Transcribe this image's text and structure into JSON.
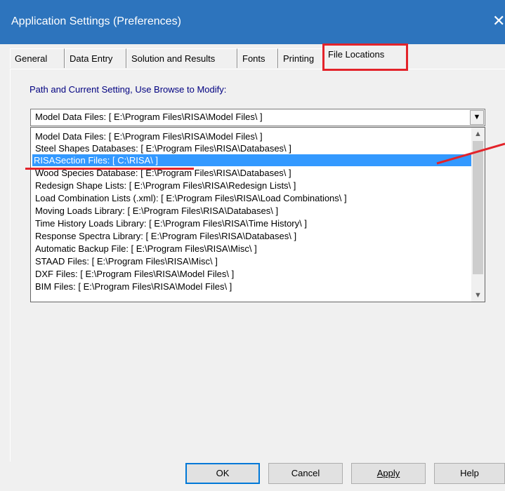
{
  "window": {
    "title": "Application Settings (Preferences)",
    "close_glyph": "✕"
  },
  "tabs": [
    {
      "label": "General"
    },
    {
      "label": "Data Entry"
    },
    {
      "label": "Solution and Results"
    },
    {
      "label": "Fonts"
    },
    {
      "label": "Printing"
    },
    {
      "label": "File Locations",
      "active": true
    }
  ],
  "panel": {
    "caption": "Path and Current Setting, Use Browse to Modify:"
  },
  "combo": {
    "value": "Model Data Files:  [ E:\\Program Files\\RISA\\Model Files\\ ]",
    "drop_icon": "▼"
  },
  "list": {
    "items": [
      {
        "label": "Model Data Files:  [ E:\\Program Files\\RISA\\Model Files\\ ]"
      },
      {
        "label": "Steel Shapes Databases:  [ E:\\Program Files\\RISA\\Databases\\ ]"
      },
      {
        "label": "RISASection Files:  [ C:\\RISA\\ ]",
        "selected": true
      },
      {
        "label": "Wood Species Database:  [ E:\\Program Files\\RISA\\Databases\\ ]"
      },
      {
        "label": "Redesign Shape Lists:  [ E:\\Program Files\\RISA\\Redesign Lists\\ ]"
      },
      {
        "label": "Load Combination Lists (.xml):  [ E:\\Program Files\\RISA\\Load Combinations\\ ]"
      },
      {
        "label": "Moving Loads Library:  [ E:\\Program Files\\RISA\\Databases\\ ]"
      },
      {
        "label": "Time History Loads Library:  [ E:\\Program Files\\RISA\\Time History\\ ]"
      },
      {
        "label": "Response Spectra Library:  [ E:\\Program Files\\RISA\\Databases\\ ]"
      },
      {
        "label": "Automatic Backup File:  [ E:\\Program Files\\RISA\\Misc\\ ]"
      },
      {
        "label": "STAAD Files:  [ E:\\Program Files\\RISA\\Misc\\ ]"
      },
      {
        "label": "DXF Files:  [ E:\\Program Files\\RISA\\Model Files\\ ]"
      },
      {
        "label": "BIM Files:  [ E:\\Program Files\\RISA\\Model Files\\ ]"
      }
    ],
    "scroll_up_icon": "▲",
    "scroll_down_icon": "▼"
  },
  "buttons": {
    "ok": "OK",
    "cancel": "Cancel",
    "apply": "Apply",
    "help": "Help"
  },
  "colors": {
    "titlebar": "#2d74bd",
    "selection": "#3399ff",
    "annotation": "#e3232a",
    "caption": "#000080"
  }
}
